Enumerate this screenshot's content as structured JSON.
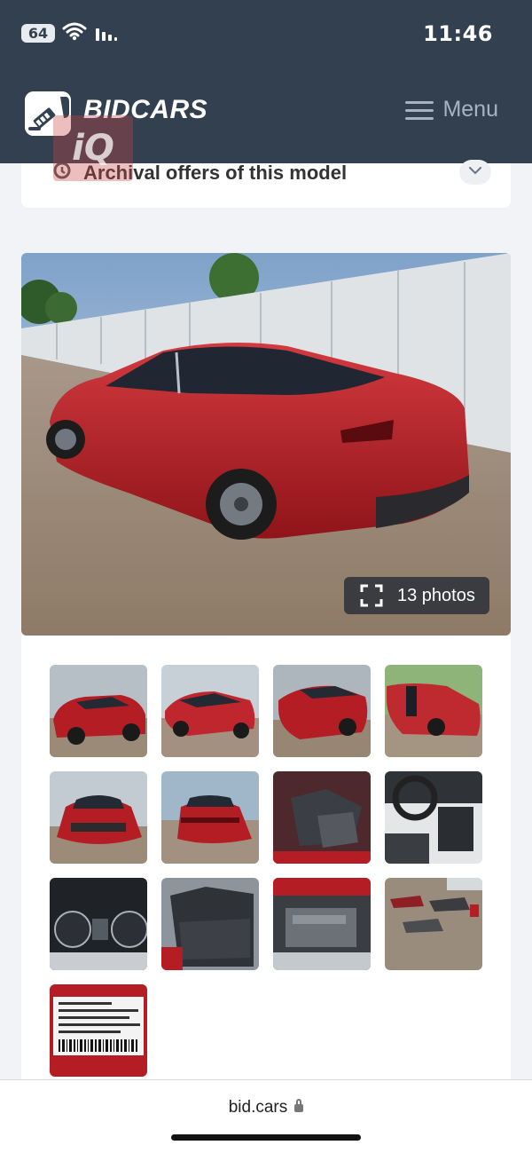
{
  "status_bar": {
    "battery": "64",
    "time": "11:46"
  },
  "header": {
    "logo_text": "BIDCARS",
    "menu_label": "Menu"
  },
  "watermark": {
    "text": "iQ"
  },
  "archive": {
    "title": "Archival offers of this model"
  },
  "gallery": {
    "photo_count_label": "13 photos",
    "thumbnails": [
      "front-left exterior",
      "rear-left exterior",
      "rear-left exterior close",
      "front-right damage",
      "front view",
      "rear view",
      "front seats interior",
      "dashboard steering wheel",
      "instrument cluster",
      "rear seats",
      "engine bay",
      "loose parts",
      "manufacturer label"
    ]
  },
  "browser": {
    "url": "bid.cars"
  },
  "colors": {
    "header_bg": "#334050",
    "car_red": "#b51d24"
  }
}
